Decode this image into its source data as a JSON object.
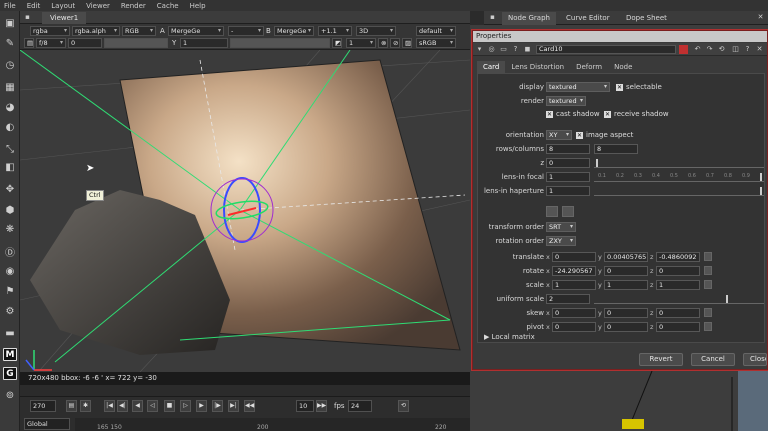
{
  "menubar": [
    "File",
    "Edit",
    "Layout",
    "Viewer",
    "Render",
    "Cache",
    "Help"
  ],
  "viewer": {
    "tab": "Viewer1",
    "channels": "rgba",
    "alpha": "rgba.alph",
    "display_channel": "RGB",
    "a_input": "MergeGe",
    "compare_mode": "-",
    "b_label": "B",
    "b_input": "MergeGe",
    "gamma_label": "+1.1",
    "view_mode": "3D",
    "camera": "default",
    "fstop": "f/8",
    "exposure": "0",
    "y_label": "Y",
    "y_value": "1",
    "frame": "1",
    "colorspace": "sRGB",
    "ctrl_tip": "Ctrl",
    "info": "720x480 bbox: -6 -6 ' x= 722 y= -30"
  },
  "timeline": {
    "frame": "270",
    "step": "10",
    "fps_label": "fps",
    "fps": "24",
    "range_mode": "Global",
    "ruler_ticks": [
      "165 150",
      "200",
      "220"
    ]
  },
  "right_tabs": [
    "Node Graph",
    "Curve Editor",
    "Dope Sheet"
  ],
  "properties": {
    "title": "Properties",
    "node_name": "Card10",
    "tabs": [
      "Card",
      "Lens Distortion",
      "Deform",
      "Node"
    ],
    "display": {
      "label": "display",
      "value": "textured",
      "check": "selectable"
    },
    "render": {
      "label": "render",
      "value": "textured"
    },
    "cast_shadow": "cast shadow",
    "receive_shadow": "receive shadow",
    "orientation": {
      "label": "orientation",
      "value": "XY",
      "check": "image aspect"
    },
    "rows_columns": {
      "label": "rows/columns",
      "rows": "8",
      "cols": "8"
    },
    "z": {
      "label": "z",
      "value": "0"
    },
    "lens_focal": {
      "label": "lens-in focal",
      "value": "1"
    },
    "lens_haperture": {
      "label": "lens-in haperture",
      "value": "1"
    },
    "slider_ticks": [
      "0.1",
      "0.2",
      "0.3",
      "0.4",
      "0.5",
      "0.6",
      "0.7",
      "0.8",
      "0.9"
    ],
    "transform_order": {
      "label": "transform order",
      "value": "SRT"
    },
    "rotation_order": {
      "label": "rotation order",
      "value": "ZXY"
    },
    "translate": {
      "label": "translate",
      "x": "0",
      "y": "0.00405765",
      "z": "-0.4860092"
    },
    "rotate": {
      "label": "rotate",
      "x": "-24.290567",
      "y": "0",
      "z": "0"
    },
    "scale": {
      "label": "scale",
      "x": "1",
      "y": "1",
      "z": "1"
    },
    "uniform_scale": {
      "label": "uniform scale",
      "value": "2"
    },
    "skew": {
      "label": "skew",
      "x": "0",
      "y": "0",
      "z": "0"
    },
    "pivot": {
      "label": "pivot",
      "x": "0",
      "y": "0",
      "z": "0"
    },
    "local_matrix": "Local matrix",
    "axis_x": "x",
    "axis_y": "y",
    "axis_z": "z",
    "buttons": {
      "revert": "Revert",
      "cancel": "Cancel",
      "close": "Close"
    }
  },
  "colors": {
    "accent_border": "#b03030",
    "gizmo_ring": "#3a4bff",
    "gizmo_green": "#22dd66"
  }
}
